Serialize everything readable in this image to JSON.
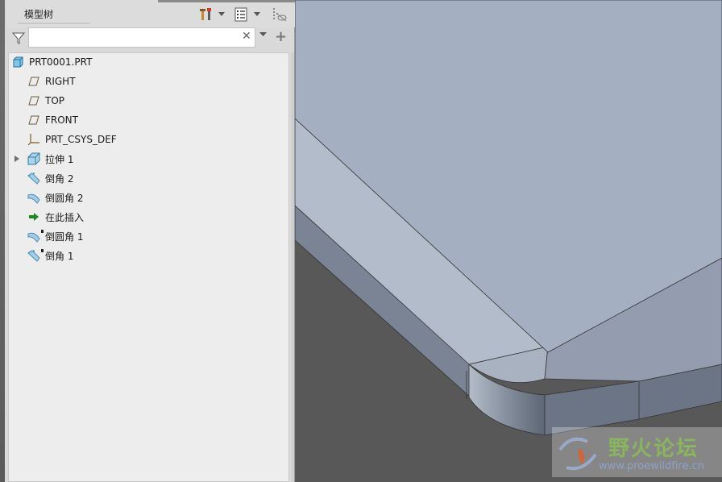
{
  "panel": {
    "tab_title": "模型树",
    "search": {
      "value": "",
      "placeholder": ""
    },
    "toolbar": {
      "settings_icon": "tools-icon",
      "columns_icon": "list-icon",
      "show_icon": "show-hide-icon"
    }
  },
  "tree": {
    "items": [
      {
        "label": "PRT0001.PRT",
        "icon": "part-icon"
      },
      {
        "label": "RIGHT",
        "icon": "datum-plane-icon"
      },
      {
        "label": "TOP",
        "icon": "datum-plane-icon"
      },
      {
        "label": "FRONT",
        "icon": "datum-plane-icon"
      },
      {
        "label": "PRT_CSYS_DEF",
        "icon": "csys-icon"
      },
      {
        "label": "拉伸 1",
        "icon": "extrude-icon"
      },
      {
        "label": "倒角 2",
        "icon": "chamfer-icon"
      },
      {
        "label": "倒圆角 2",
        "icon": "round-icon"
      },
      {
        "label": "在此插入",
        "icon": "insert-here-icon"
      },
      {
        "label": "倒圆角 1",
        "icon": "round-icon"
      },
      {
        "label": "倒角 1",
        "icon": "chamfer-icon"
      }
    ]
  },
  "watermark": {
    "title": "野火论坛",
    "url": "www.proewildfire.cn"
  },
  "colors": {
    "part_face": "#a4b0c2",
    "part_side": "#7e8797",
    "background": "#585858",
    "insert_arrow": "#1a8a1a"
  }
}
